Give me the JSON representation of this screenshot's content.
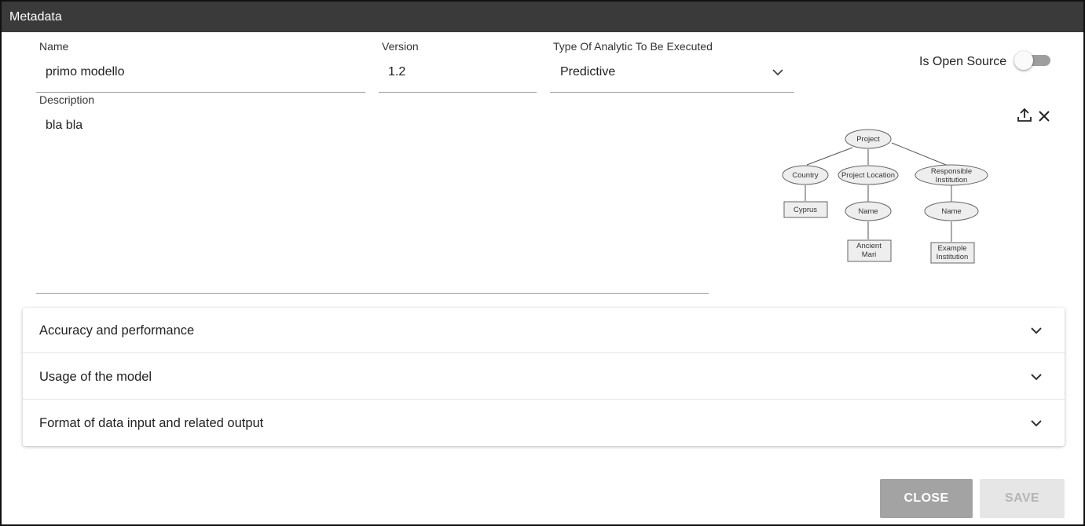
{
  "dialog": {
    "title": "Metadata"
  },
  "fields": {
    "name": {
      "label": "Name",
      "value": "primo modello"
    },
    "version": {
      "label": "Version",
      "value": "1.2"
    },
    "analytic_type": {
      "label": "Type Of Analytic To Be Executed",
      "value": "Predictive",
      "icon": "chevron-down-icon"
    },
    "open_source": {
      "label": "Is Open Source",
      "checked": false
    },
    "description": {
      "label": "Description",
      "value": "bla bla"
    }
  },
  "image_actions": {
    "upload_icon": "upload-icon",
    "remove_icon": "close-icon"
  },
  "diagram": {
    "root": "Project",
    "country": "Country",
    "cyprus": "Cyprus",
    "project_location": "Project Location",
    "location_name": "Name",
    "ancient_1": "Ancient",
    "ancient_2": "Mari",
    "responsible_1": "Responsible",
    "responsible_2": "Institution",
    "institution_name": "Name",
    "example_1": "Example",
    "example_2": "Institution"
  },
  "accordion": [
    {
      "title": "Accuracy and performance"
    },
    {
      "title": "Usage of the model"
    },
    {
      "title": "Format of data input and related output"
    }
  ],
  "actions": {
    "close": "CLOSE",
    "save": "SAVE"
  }
}
